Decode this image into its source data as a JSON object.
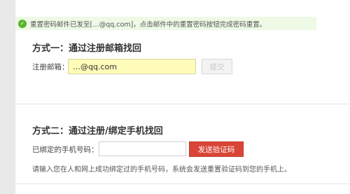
{
  "notice": {
    "icon": "check-circle-icon",
    "text": "重置密码邮件已发至[…@qq.com]，点击邮件中的重置密码按钮完成密码重置。"
  },
  "method1": {
    "title": "方式一：通过注册邮箱找回",
    "email_label": "注册邮箱：",
    "email_value": "…@qq.com",
    "submit_label": "提交"
  },
  "method2": {
    "title": "方式二：通过注册/绑定手机找回",
    "phone_label": "已绑定的手机号码：",
    "phone_value": "",
    "send_label": "发送验证码",
    "hint": "请输入您在人和网上成功绑定过的手机号码，系统会发送重置验证码到您的手机上。"
  },
  "colors": {
    "send_button": "#d94536",
    "notice_bg": "#eef9e6",
    "email_input_bg": "#fffbb8"
  }
}
